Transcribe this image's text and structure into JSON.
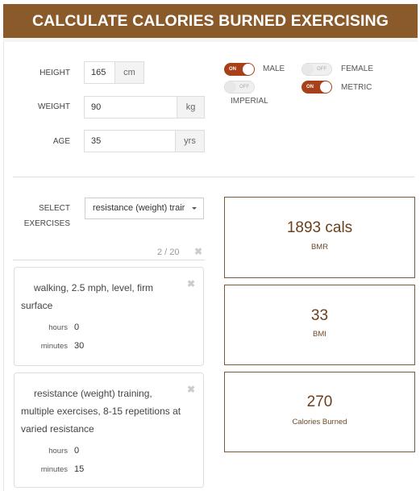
{
  "header": {
    "title": "CALCULATE CALORIES BURNED EXERCISING"
  },
  "colors": {
    "brand": "#8b5a2b",
    "toggle_on": "#a8401a",
    "result_border": "#7a5a36"
  },
  "profile": {
    "height": {
      "label": "HEIGHT",
      "value": "165",
      "unit": "cm"
    },
    "weight": {
      "label": "WEIGHT",
      "value": "90",
      "unit": "kg"
    },
    "age": {
      "label": "AGE",
      "value": "35",
      "unit": "yrs"
    }
  },
  "toggles": {
    "male": {
      "label": "MALE",
      "state": "ON"
    },
    "female": {
      "label": "FEMALE",
      "state": "OFF"
    },
    "imperial": {
      "label": "IMPERIAL",
      "state": "OFF"
    },
    "metric": {
      "label": "METRIC",
      "state": "ON"
    }
  },
  "exercise_select": {
    "label_line1": "SELECT",
    "label_line2": "EXERCISES",
    "selected": "resistance (weight) trair",
    "count": "2 / 20",
    "clear_icon": "✖"
  },
  "exercises": [
    {
      "name": "walking, 2.5 mph, level, firm surface",
      "hours_label": "hours",
      "hours": "0",
      "minutes_label": "minutes",
      "minutes": "30",
      "remove_icon": "✖"
    },
    {
      "name": "resistance (weight) training, multiple exercises, 8-15 repetitions at varied resistance",
      "hours_label": "hours",
      "hours": "0",
      "minutes_label": "minutes",
      "minutes": "15",
      "remove_icon": "✖"
    }
  ],
  "results": {
    "bmr": {
      "value": "1893 cals",
      "label": "BMR"
    },
    "bmi": {
      "value": "33",
      "label": "BMI"
    },
    "calories": {
      "value": "270",
      "label": "Calories Burned"
    }
  }
}
